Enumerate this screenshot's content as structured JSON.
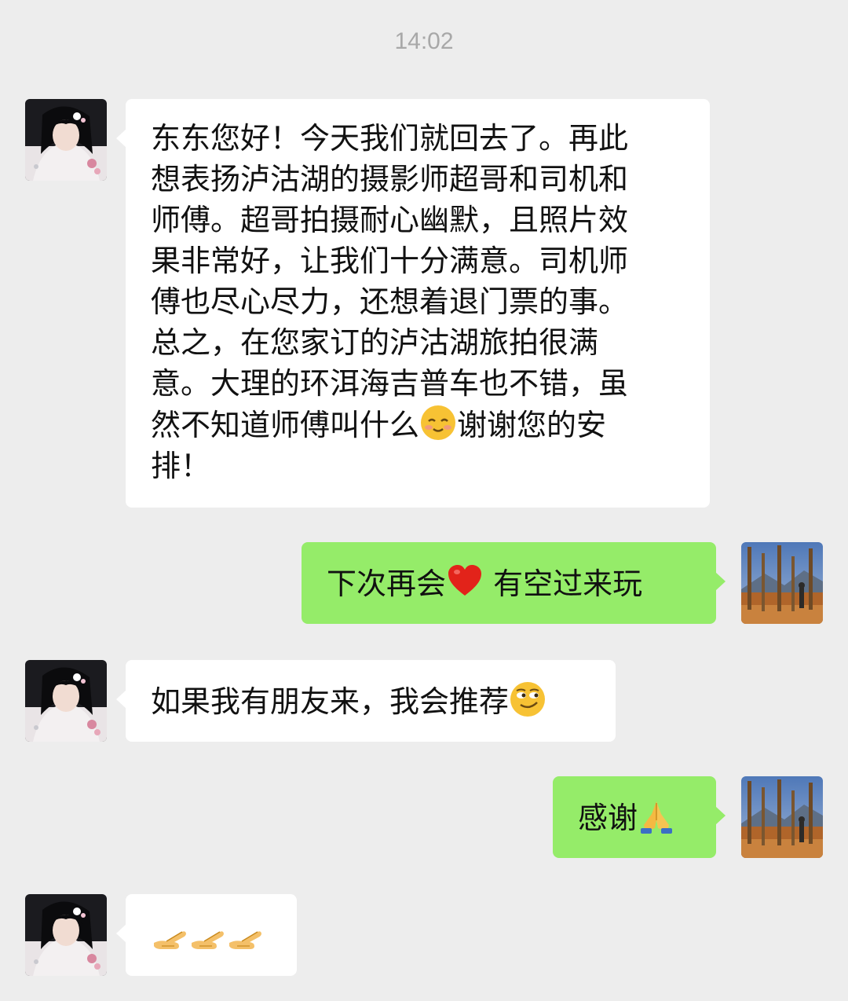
{
  "timestamp": "14:02",
  "messages": [
    {
      "side": "in",
      "text_lines": [
        "东东您好！今天我们就回去了。再此",
        "想表扬泸沽湖的摄影师超哥和司机和",
        "师傅。超哥拍摄耐心幽默，且照片效",
        "果非常好，让我们十分满意。司机师",
        "傅也尽心尽力，还想着退门票的事。",
        "总之，在您家订的泸沽湖旅拍很满",
        "意。大理的环洱海吉普车也不错，虽"
      ],
      "line8_before": "然不知道师傅叫什么",
      "line8_emoji": "blush-face-emoji",
      "line8_after": "谢谢您的安",
      "line9": "排！"
    },
    {
      "side": "out",
      "text_before": "下次再会",
      "emoji": "red-heart-emoji",
      "text_after": " 有空过来玩"
    },
    {
      "side": "in",
      "text_before": "如果我有朋友来，我会推荐",
      "emoji": "smirk-face-emoji"
    },
    {
      "side": "out",
      "text_before": "感谢",
      "emoji": "folded-hands-emoji"
    },
    {
      "side": "in",
      "emoji": "pointing-hand-emoji",
      "emoji_count": 3
    }
  ],
  "avatars": {
    "contact": "anime-girl-avatar",
    "self": "landscape-photo-avatar"
  },
  "colors": {
    "background": "#ededed",
    "incoming_bubble": "#ffffff",
    "outgoing_bubble": "#95ec69",
    "timestamp_text": "#a8a8a8"
  }
}
